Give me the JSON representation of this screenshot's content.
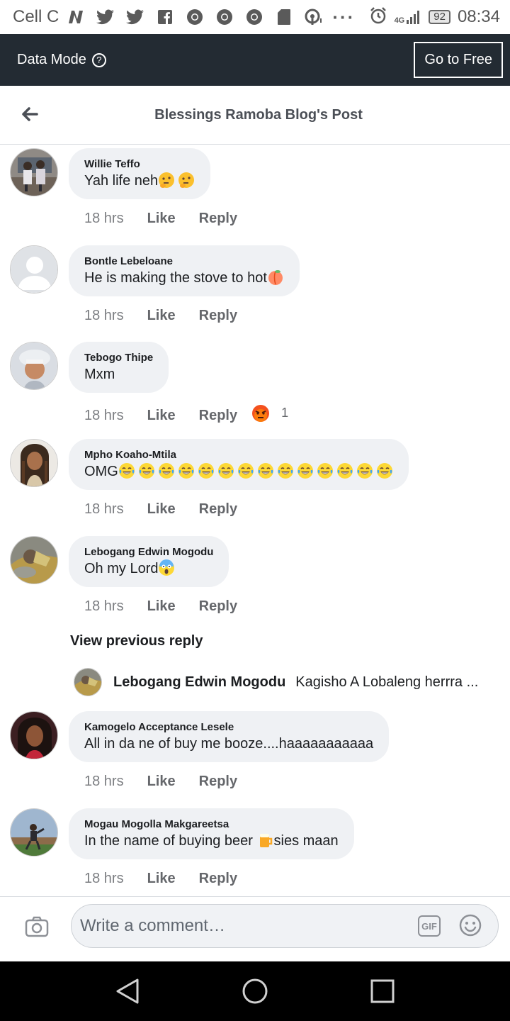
{
  "status_bar": {
    "carrier": "Cell C",
    "battery": "92",
    "network": "4G",
    "time": "08:34",
    "icons": [
      "n-icon",
      "twitter-icon",
      "twitter-icon",
      "facebook-icon",
      "chrome-icon",
      "chrome-icon",
      "chrome-icon",
      "sd-card-icon",
      "wifi-hotspot-icon",
      "more-icon"
    ]
  },
  "data_bar": {
    "label": "Data Mode",
    "help_glyph": "?",
    "button": "Go to Free"
  },
  "header": {
    "title": "Blessings Ramoba Blog's Post"
  },
  "actions": {
    "like": "Like",
    "reply": "Reply"
  },
  "comments": [
    {
      "name": "Willie Teffo",
      "text": "Yah life neh",
      "time": "18 hrs",
      "emojis": [
        "thinking-emoji",
        "thinking-emoji"
      ]
    },
    {
      "name": "Bontle Lebeloane",
      "text": "He is making the stove to hot",
      "time": "18 hrs",
      "emojis": [
        "peach-emoji"
      ]
    },
    {
      "name": "Tebogo Thipe",
      "text": "Mxm",
      "time": "18 hrs",
      "reaction": {
        "icon": "angry-reaction-icon",
        "count": "1"
      }
    },
    {
      "name": "Mpho Koaho-Mtila",
      "text": "OMG",
      "time": "18 hrs",
      "emoji_repeat": 14,
      "emojis": [
        "tears-of-joy-emoji"
      ]
    },
    {
      "name": "Lebogang Edwin Mogodu",
      "text": "Oh my Lord",
      "time": "18 hrs",
      "emojis": [
        "screaming-emoji"
      ]
    },
    {
      "name": "Kamogelo Acceptance Lesele",
      "text": "All in da ne of buy me booze....haaaaaaaaaaa",
      "time": "18 hrs"
    },
    {
      "name": "Mogau Mogolla Makgareetsa",
      "text_before": "In the name of buying beer ",
      "text_after": "sies maan",
      "time": "18 hrs",
      "emojis": [
        "beer-emoji"
      ]
    }
  ],
  "view_previous": "View previous reply",
  "reply_preview": {
    "name": "Lebogang Edwin Mogodu",
    "text": "Kagisho A Lobaleng herrra ..."
  },
  "composer": {
    "placeholder": "Write a comment…",
    "gif_label": "GIF"
  },
  "colors": {
    "data_bar_bg": "#232b33",
    "bubble_bg": "#eff1f4",
    "nav_bar_bg": "#000000"
  }
}
